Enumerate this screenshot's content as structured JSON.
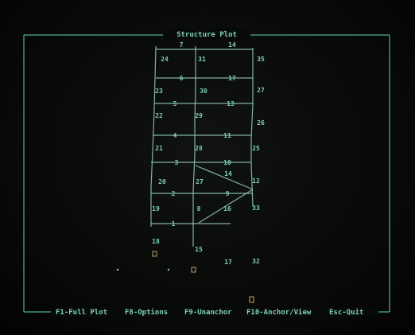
{
  "window": {
    "title": "Structure Plot"
  },
  "function_keys": [
    {
      "label": "F1-Full Plot"
    },
    {
      "label": "F8-Options"
    },
    {
      "label": "F9-Unanchor"
    },
    {
      "label": "F10-Anchor/View"
    },
    {
      "label": "Esc-Quit"
    }
  ],
  "plot": {
    "joint_labels": [
      "7",
      "14",
      "24",
      "31",
      "35",
      "6",
      "17",
      "23",
      "30",
      "27",
      "5",
      "13",
      "22",
      "29",
      "26",
      "4",
      "11",
      "21",
      "28",
      "25",
      "3",
      "10",
      "20",
      "27",
      "12",
      "14",
      "2",
      "9",
      "19",
      "16",
      "33",
      "1",
      "8",
      "18",
      "15",
      "17",
      "32"
    ],
    "colors": {
      "phosphor": "#7fd0bd",
      "frame": "#4fae9c",
      "background": "#0a0c0a"
    }
  }
}
